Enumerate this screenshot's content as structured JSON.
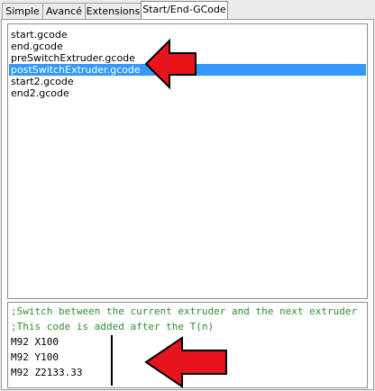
{
  "tabs": [
    {
      "label": "Simple",
      "active": false
    },
    {
      "label": "Avancé",
      "active": false
    },
    {
      "label": "Extensions",
      "active": false
    },
    {
      "label": "Start/End-GCode",
      "active": true
    }
  ],
  "files": [
    "start.gcode",
    "end.gcode",
    "preSwitchExtruder.gcode",
    "postSwitchExtruder.gcode",
    "start2.gcode",
    "end2.gcode"
  ],
  "selected_file": "postSwitchExtruder.gcode",
  "editor": {
    "lines": [
      {
        "text": ";Switch between the current extruder and the next extruder",
        "kind": "comment"
      },
      {
        "text": ";This code is added after the T(n)",
        "kind": "comment"
      },
      {
        "text": "M92 X100",
        "kind": "code"
      },
      {
        "text": "M92 Y100",
        "kind": "code"
      },
      {
        "text": "M92 Z2133.33",
        "kind": "code"
      }
    ]
  },
  "colors": {
    "selection": "#3399ff",
    "comment": "#2f8f2f",
    "annotation_arrow": "#e8141b"
  },
  "annotations": [
    "red-arrow-pointing-left",
    "red-arrow-pointing-left"
  ]
}
